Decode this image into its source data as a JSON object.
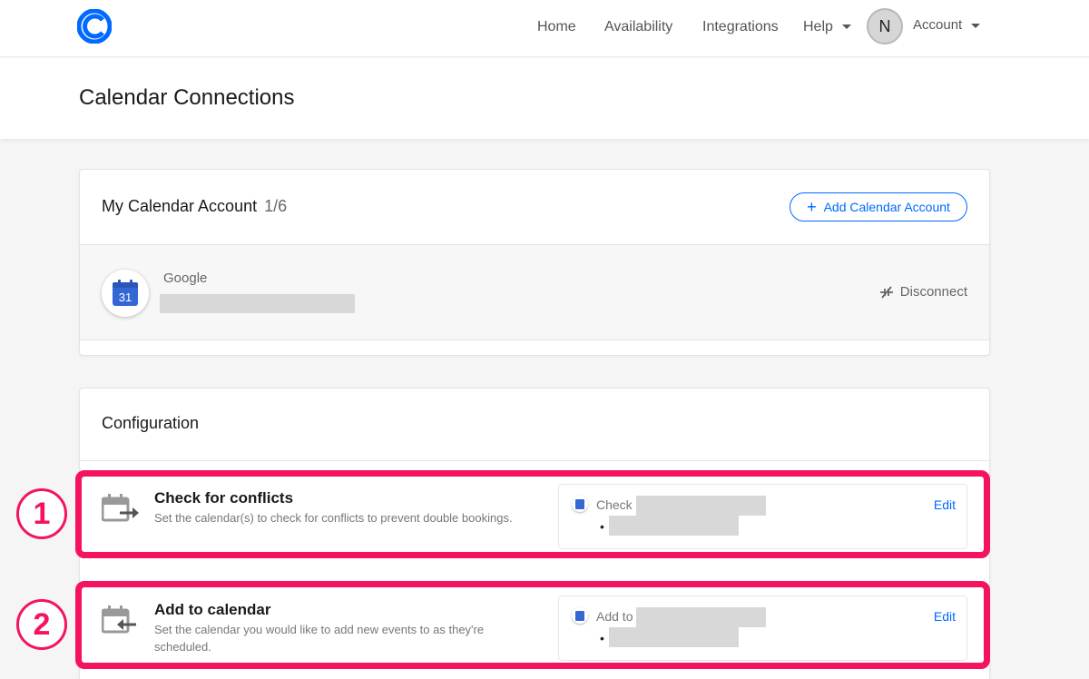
{
  "nav": {
    "home": "Home",
    "availability": "Availability",
    "integrations": "Integrations",
    "help": "Help",
    "avatar_initial": "N",
    "account": "Account"
  },
  "page": {
    "title": "Calendar Connections"
  },
  "calendar_account": {
    "title": "My Calendar Account",
    "count": "1/6",
    "add_button": "Add Calendar Account",
    "provider": "Google",
    "calendar_day": "31",
    "disconnect": "Disconnect"
  },
  "configuration": {
    "title": "Configuration",
    "rows": [
      {
        "number": "1",
        "title": "Check for conflicts",
        "description": "Set the calendar(s) to check for conflicts to prevent double bookings.",
        "detail_label": "Check",
        "bullet": "•",
        "edit": "Edit"
      },
      {
        "number": "2",
        "title": "Add to calendar",
        "description": "Set the calendar you would like to add new events to as they're scheduled.",
        "detail_label": "Add to",
        "bullet": "•",
        "edit": "Edit"
      }
    ]
  },
  "colors": {
    "brand_blue": "#0069ff",
    "highlight_pink": "#f5135f",
    "google_blue": "#3367d6"
  }
}
